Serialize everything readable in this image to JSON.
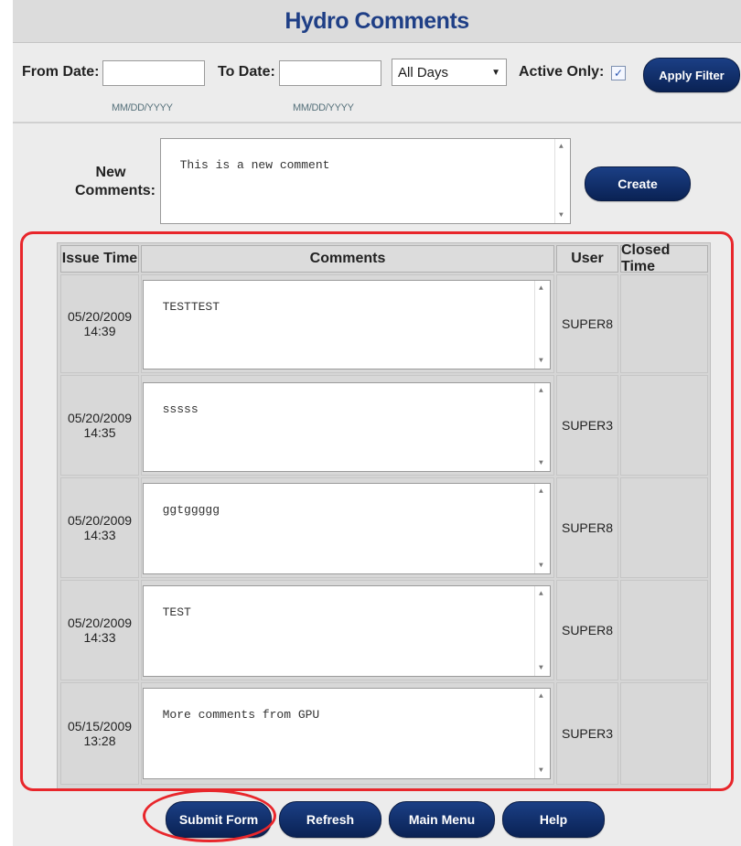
{
  "title": "Hydro Comments",
  "filter": {
    "from_label": "From Date:",
    "from_value": "",
    "from_hint": "MM/DD/YYYY",
    "to_label": "To Date:",
    "to_value": "",
    "to_hint": "MM/DD/YYYY",
    "days_selected": "All Days",
    "active_label": "Active Only:",
    "active_checked": true,
    "apply_label": "Apply Filter"
  },
  "new_comment": {
    "label_line1": "New",
    "label_line2": "Comments:",
    "value": "This is a new comment",
    "create_label": "Create"
  },
  "table": {
    "headers": [
      "Issue Time",
      "Comments",
      "User",
      "Closed Time"
    ],
    "rows": [
      {
        "date": "05/20/2009",
        "time": "14:39",
        "comment": "TESTTEST",
        "user": "SUPER8",
        "closed": ""
      },
      {
        "date": "05/20/2009",
        "time": "14:35",
        "comment": "sssss",
        "user": "SUPER3",
        "closed": ""
      },
      {
        "date": "05/20/2009",
        "time": "14:33",
        "comment": "ggtggggg",
        "user": "SUPER8",
        "closed": ""
      },
      {
        "date": "05/20/2009",
        "time": "14:33",
        "comment": "TEST",
        "user": "SUPER8",
        "closed": ""
      },
      {
        "date": "05/15/2009",
        "time": "13:28",
        "comment": "More comments from GPU",
        "user": "SUPER3",
        "closed": ""
      }
    ]
  },
  "footer": {
    "submit": "Submit Form",
    "refresh": "Refresh",
    "main_menu": "Main Menu",
    "help": "Help"
  },
  "colors": {
    "title": "#1f3f86",
    "button": "#0d2a60",
    "highlight": "#e8262b"
  }
}
